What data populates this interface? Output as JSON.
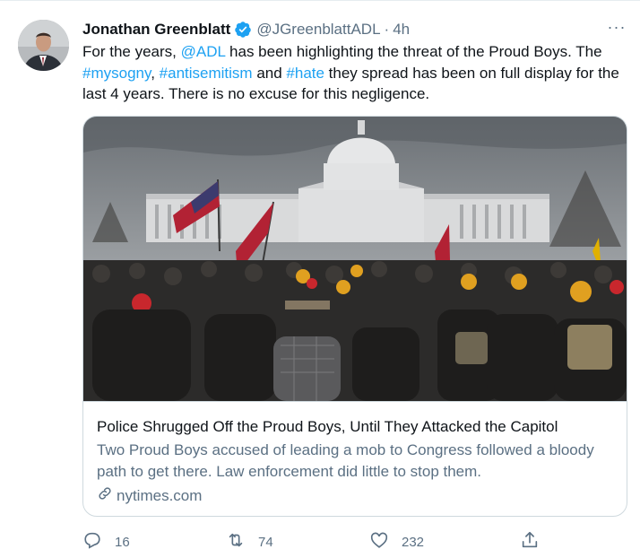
{
  "tweet": {
    "author_name": "Jonathan Greenblatt",
    "handle": "@JGreenblattADL",
    "separator": "·",
    "time": "4h",
    "more_label": "···",
    "text": {
      "t1": "For the years, ",
      "mention": "@ADL",
      "t2": " has been highlighting the threat of the Proud Boys. The ",
      "tag1": "#mysogny",
      "t3": ", ",
      "tag2": "#antisemitism",
      "t4": " and ",
      "tag3": "#hate",
      "t5": " they spread has been on full display for the last 4 years. There is no excuse for this negligence."
    }
  },
  "card": {
    "title": "Police Shrugged Off the Proud Boys, Until They Attacked the Capitol",
    "description": "Two Proud Boys accused of leading a mob to Congress followed a bloody path to get there. Law enforcement did little to stop them.",
    "domain": "nytimes.com"
  },
  "actions": {
    "reply_count": "16",
    "retweet_count": "74",
    "like_count": "232"
  },
  "colors": {
    "link": "#1da1f2",
    "secondary": "#5b7083",
    "border": "#cfd9de"
  },
  "icons": [
    "verified-badge-icon",
    "more-icon",
    "link-icon",
    "reply-icon",
    "retweet-icon",
    "like-icon",
    "share-icon"
  ]
}
